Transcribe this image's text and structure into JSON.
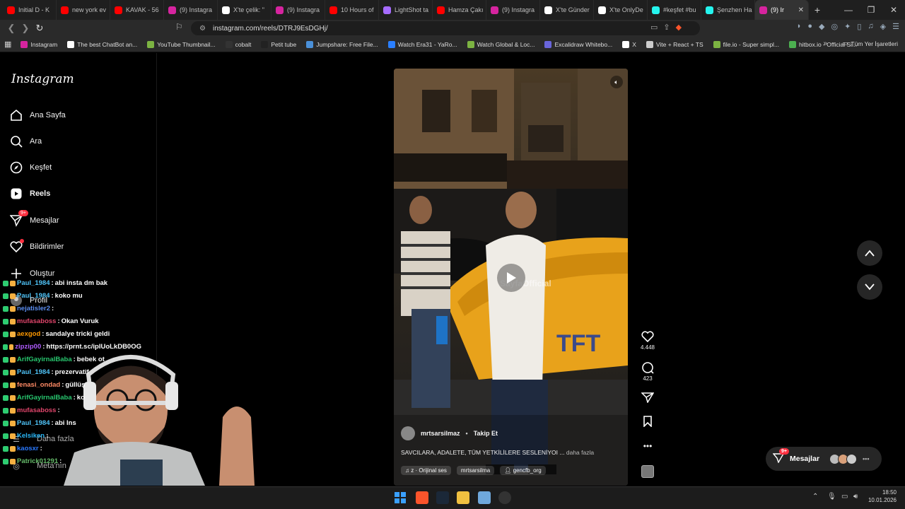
{
  "browser": {
    "tabs": [
      {
        "label": "Initial D - K",
        "color": "#ff0000"
      },
      {
        "label": "new york ev",
        "color": "#ff0000"
      },
      {
        "label": "KAVAK - 56",
        "color": "#ff0000"
      },
      {
        "label": "(9) Instagra",
        "color": "#d6249f"
      },
      {
        "label": "X'te çelik: \"",
        "color": "#ffffff"
      },
      {
        "label": "(9) Instagra",
        "color": "#d6249f"
      },
      {
        "label": "10 Hours of",
        "color": "#ff0000"
      },
      {
        "label": "LightShot ta",
        "color": "#a66cff"
      },
      {
        "label": "Hamza Çakı",
        "color": "#ff0000"
      },
      {
        "label": "(9) Instagra",
        "color": "#d6249f"
      },
      {
        "label": "X'te Günder",
        "color": "#ffffff"
      },
      {
        "label": "X'te OnlyDe",
        "color": "#ffffff"
      },
      {
        "label": "#keşfet #bu",
        "color": "#25f4ee"
      },
      {
        "label": "Şenzhen Ha",
        "color": "#25f4ee"
      },
      {
        "label": "(9) Ir",
        "color": "#d6249f",
        "active": true
      }
    ],
    "url": "instagram.com/reels/DTRJ9EsDGHj/",
    "bookmarks": [
      {
        "label": "Instagram",
        "color": "#d6249f"
      },
      {
        "label": "The best ChatBot an...",
        "color": "#ffffff"
      },
      {
        "label": "YouTube Thumbnail...",
        "color": "#7cb342"
      },
      {
        "label": "cobalt",
        "color": "#333333"
      },
      {
        "label": "Petit tube",
        "color": "#222222"
      },
      {
        "label": "Jumpshare: Free File...",
        "color": "#4a90d9"
      },
      {
        "label": "Watch Era31 - YaRo...",
        "color": "#2a7fff"
      },
      {
        "label": "Watch Global & Loc...",
        "color": "#7cb342"
      },
      {
        "label": "Excalidraw Whitebo...",
        "color": "#6965db"
      },
      {
        "label": "X",
        "color": "#ffffff"
      },
      {
        "label": "Vite + React + TS",
        "color": "#cccccc"
      },
      {
        "label": "file.io - Super simpl...",
        "color": "#7cb342"
      },
      {
        "label": "hitbox.io - Official Si...",
        "color": "#4caf50"
      }
    ],
    "all_bookmarks": "Tüm Yer İşaretleri"
  },
  "instagram": {
    "logo": "Instagram",
    "nav": [
      {
        "label": "Ana Sayfa",
        "icon": "home-icon"
      },
      {
        "label": "Ara",
        "icon": "search-icon"
      },
      {
        "label": "Keşfet",
        "icon": "compass-icon"
      },
      {
        "label": "Reels",
        "icon": "reels-icon",
        "active": true
      },
      {
        "label": "Mesajlar",
        "icon": "messages-icon",
        "badge": "9+"
      },
      {
        "label": "Bildirimler",
        "icon": "heart-icon"
      },
      {
        "label": "Oluştur",
        "icon": "plus-icon"
      },
      {
        "label": "Profil",
        "icon": "profile-icon"
      }
    ],
    "bottom_nav": [
      {
        "label": "Daha fazla"
      },
      {
        "label": "Meta'nın"
      }
    ],
    "reel": {
      "username": "mrtsarsilmaz",
      "follow": "Takip Et",
      "caption": "SAVCILARA, ADALETE, TÜM YETKİLİLERE SESLENİYOI ...",
      "more": "daha fazla",
      "audio": "z · Orijinal ses",
      "tag1": "mrtsarsilma",
      "tag2": "gencfb_org",
      "watermark": "SayfaOfficial",
      "taxi_text": "TFT",
      "likes": "4.448",
      "comments": "423"
    },
    "messages_pill": {
      "label": "Mesajlar",
      "badge": "9+"
    }
  },
  "chat": [
    {
      "user": "Paul_1984",
      "msg": "abi insta dm bak",
      "color": "#4fc3f7"
    },
    {
      "user": "Paul_1984",
      "msg": "koko mu",
      "color": "#4fc3f7"
    },
    {
      "user": "nejatisler2",
      "msg": "",
      "color": "#5b8def"
    },
    {
      "user": "mufasaboss",
      "msg": "Okan Vuruk",
      "color": "#e0456b"
    },
    {
      "user": "aexgod",
      "msg": "sandalye tricki geldi",
      "color": "#ff9900"
    },
    {
      "user": "zipzip00",
      "msg": "https://prnt.sc/ipIUoLkDB0OG",
      "color": "#b05cff"
    },
    {
      "user": "ArifGayirnalBaba",
      "msg": "bebek ot",
      "color": "#28c76f"
    },
    {
      "user": "Paul_1984",
      "msg": "prezervatif",
      "color": "#4fc3f7"
    },
    {
      "user": "fenasi_ondad",
      "msg": "güllüş",
      "color": "#ff8a65"
    },
    {
      "user": "ArifGayirnalBaba",
      "msg": "ko",
      "color": "#28c76f"
    },
    {
      "user": "mufasaboss",
      "msg": "",
      "color": "#e0456b"
    },
    {
      "user": "Paul_1984",
      "msg": "abi Ins",
      "color": "#4fc3f7"
    },
    {
      "user": "Kelsiken",
      "msg": "",
      "color": "#29b6f6"
    },
    {
      "user": "kaosxr",
      "msg": "",
      "color": "#2979ff"
    },
    {
      "user": "Patrick01291",
      "msg": "",
      "color": "#66bb6a"
    }
  ],
  "taskbar": {
    "time": "18:50",
    "date": "10.01.2026"
  }
}
